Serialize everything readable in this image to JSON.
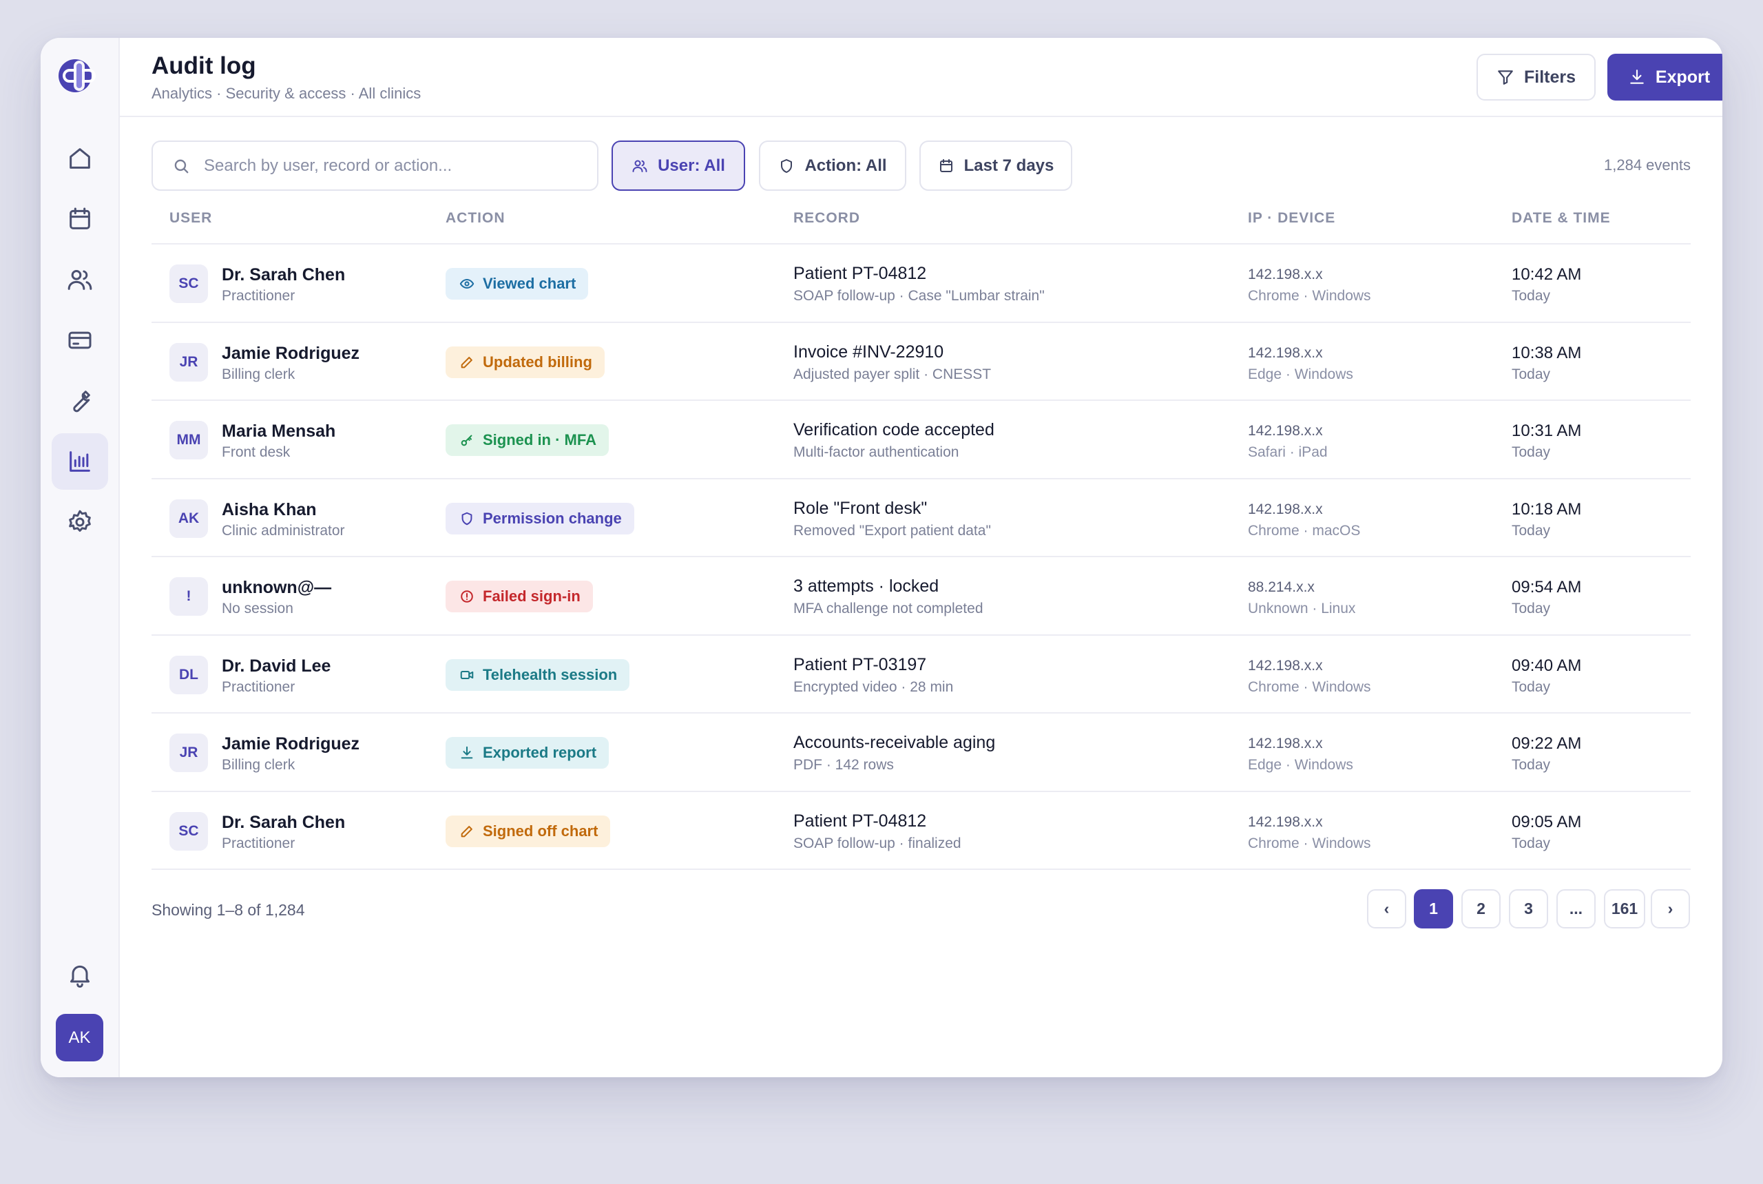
{
  "header": {
    "title": "Audit log",
    "breadcrumb": "Analytics · Security & access · All clinics",
    "filters_label": "Filters",
    "export_label": "Export"
  },
  "sidebar": {
    "items": [
      {
        "icon": "home-icon"
      },
      {
        "icon": "calendar-icon"
      },
      {
        "icon": "users-icon"
      },
      {
        "icon": "credit-card-icon"
      },
      {
        "icon": "wrench-icon"
      },
      {
        "icon": "bar-chart-icon",
        "active": true
      },
      {
        "icon": "gear-icon"
      }
    ],
    "bell_icon": "bell-icon",
    "avatar": "AK"
  },
  "toolbar": {
    "search_placeholder": "Search by user, record or action...",
    "user_filter": "User: All",
    "action_filter": "Action: All",
    "date_filter": "Last 7 days",
    "event_count": "1,284 events"
  },
  "table": {
    "columns": [
      "USER",
      "ACTION",
      "RECORD",
      "IP · DEVICE",
      "DATE & TIME"
    ],
    "rows": [
      {
        "initials": "SC",
        "name": "Dr. Sarah Chen",
        "role": "Practitioner",
        "action": "Viewed chart",
        "record": "Patient PT-04812",
        "record_sub": "SOAP follow-up · Case \"Lumbar strain\"",
        "ip": "142.198.x.x",
        "device": "Chrome · Windows",
        "time": "10:42 AM",
        "day": "Today"
      },
      {
        "initials": "JR",
        "name": "Jamie Rodriguez",
        "role": "Billing clerk",
        "action": "Updated billing",
        "record": "Invoice #INV-22910",
        "record_sub": "Adjusted payer split · CNESST",
        "ip": "142.198.x.x",
        "device": "Edge · Windows",
        "time": "10:38 AM",
        "day": "Today"
      },
      {
        "initials": "MM",
        "name": "Maria Mensah",
        "role": "Front desk",
        "action": "Signed in · MFA",
        "record": "Verification code accepted",
        "record_sub": "Multi-factor authentication",
        "ip": "142.198.x.x",
        "device": "Safari · iPad",
        "time": "10:31 AM",
        "day": "Today"
      },
      {
        "initials": "AK",
        "name": "Aisha Khan",
        "role": "Clinic administrator",
        "action": "Permission change",
        "record": "Role \"Front desk\"",
        "record_sub": "Removed \"Export patient data\"",
        "ip": "142.198.x.x",
        "device": "Chrome · macOS",
        "time": "10:18 AM",
        "day": "Today"
      },
      {
        "initials": "!",
        "name": "unknown@—",
        "role": "No session",
        "action": "Failed sign-in",
        "record": "3 attempts · locked",
        "record_sub": "MFA challenge not completed",
        "ip": "88.214.x.x",
        "device": "Unknown · Linux",
        "time": "09:54 AM",
        "day": "Today"
      },
      {
        "initials": "DL",
        "name": "Dr. David Lee",
        "role": "Practitioner",
        "action": "Telehealth session",
        "record": "Patient PT-03197",
        "record_sub": "Encrypted video · 28 min",
        "ip": "142.198.x.x",
        "device": "Chrome · Windows",
        "time": "09:40 AM",
        "day": "Today"
      },
      {
        "initials": "JR",
        "name": "Jamie Rodriguez",
        "role": "Billing clerk",
        "action": "Exported report",
        "record": "Accounts-receivable aging",
        "record_sub": "PDF · 142 rows",
        "ip": "142.198.x.x",
        "device": "Edge · Windows",
        "time": "09:22 AM",
        "day": "Today"
      },
      {
        "initials": "SC",
        "name": "Dr. Sarah Chen",
        "role": "Practitioner",
        "action": "Signed off chart",
        "record": "Patient PT-04812",
        "record_sub": "SOAP follow-up · finalized",
        "ip": "142.198.x.x",
        "device": "Chrome · Windows",
        "time": "09:05 AM",
        "day": "Today"
      }
    ]
  },
  "footer": {
    "showing": "Showing 1–8 of 1,284",
    "pages": [
      "‹",
      "1",
      "2",
      "3",
      "...",
      "161",
      "›"
    ],
    "current_page": "1"
  },
  "colors": {
    "accent": "#4a43b2",
    "badge_blue": "#1d6ea3",
    "badge_orange": "#c16a0c",
    "badge_green": "#1c9250",
    "badge_red": "#c4282c"
  }
}
